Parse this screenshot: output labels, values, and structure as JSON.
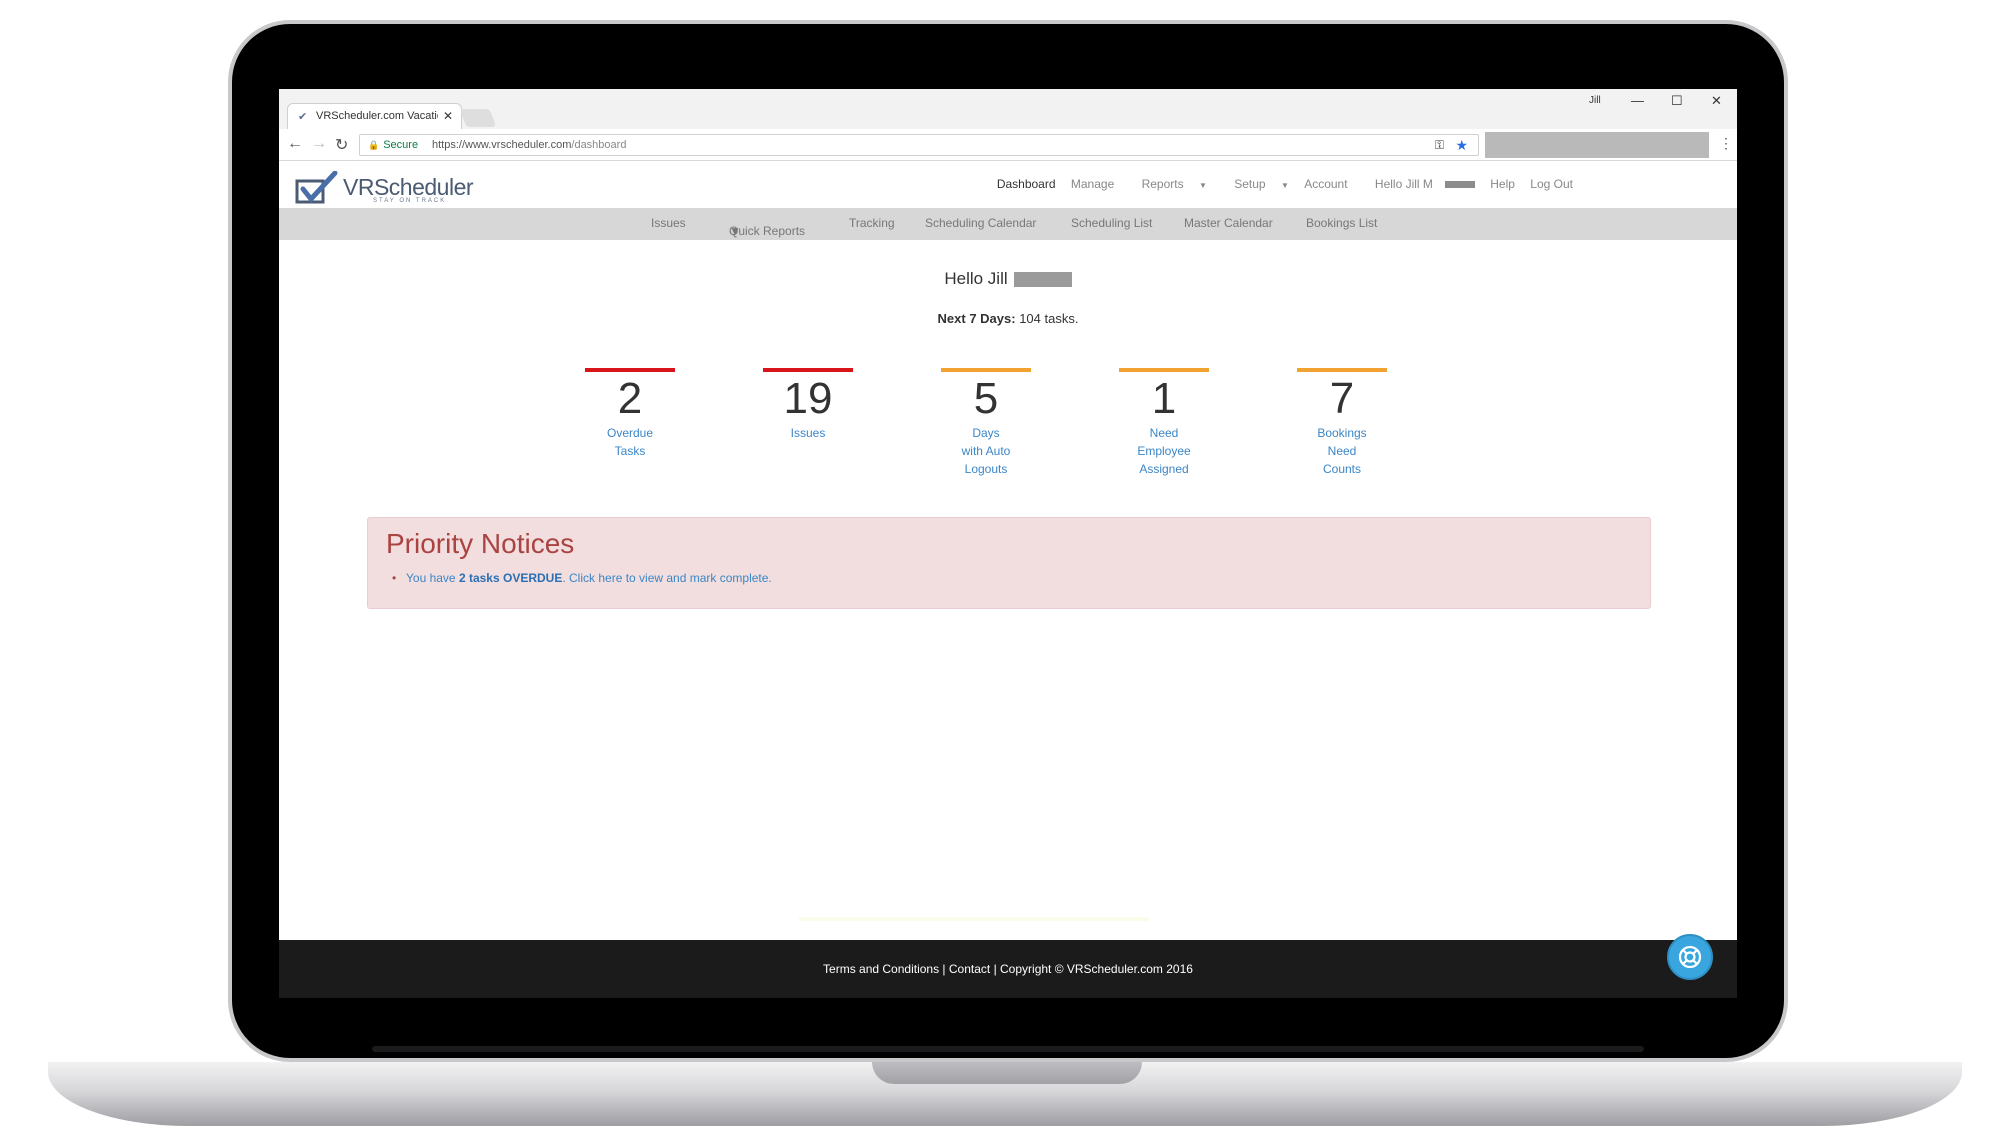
{
  "browser": {
    "tab_title": "VRScheduler.com Vacation",
    "secure_label": "Secure",
    "url_host": "https://www.vrscheduler.com",
    "url_path": "/dashboard",
    "window_controls": [
      "—",
      "☐",
      "✕"
    ]
  },
  "logo": {
    "brand": "VRScheduler",
    "tagline": "STAY ON TRACK"
  },
  "top_nav": {
    "dashboard": "Dashboard",
    "manage": "Manage",
    "reports": "Reports",
    "setup": "Setup",
    "account": "Account",
    "hello_user": "Hello Jill M",
    "help": "Help",
    "logout": "Log Out"
  },
  "sub_nav": {
    "issues": "Issues",
    "quick_reports": "Quick Reports",
    "tracking": "Tracking",
    "scheduling_calendar": "Scheduling Calendar",
    "scheduling_list": "Scheduling List",
    "master_calendar": "Master Calendar",
    "bookings_list": "Bookings List"
  },
  "dashboard": {
    "greeting": "Hello Jill",
    "next_days_label": "Next 7 Days:",
    "next_days_value": "104 tasks.",
    "stats": [
      {
        "value": "2",
        "line1": "Overdue",
        "line2": "Tasks",
        "line3": "",
        "color": "#d9151b"
      },
      {
        "value": "19",
        "line1": "Issues",
        "line2": "",
        "line3": "",
        "color": "#d9151b"
      },
      {
        "value": "5",
        "line1": "Days",
        "line2": "with Auto",
        "line3": "Logouts",
        "color": "#f2a230"
      },
      {
        "value": "1",
        "line1": "Need",
        "line2": "Employee",
        "line3": "Assigned",
        "color": "#f2a230"
      },
      {
        "value": "7",
        "line1": "Bookings",
        "line2": "Need",
        "line3": "Counts",
        "color": "#f2a230"
      }
    ]
  },
  "priority_notices": {
    "title": "Priority Notices",
    "item_prefix": "You have ",
    "item_bold": "2 tasks OVERDUE",
    "item_suffix": ". Click here to view and mark complete."
  },
  "footer": {
    "text": "Terms and Conditions | Contact | Copyright © VRScheduler.com 2016"
  },
  "colors": {
    "accent": "#3b86c7",
    "danger": "#d9151b",
    "warning": "#f2a230",
    "notice_bg": "#f2dede"
  }
}
